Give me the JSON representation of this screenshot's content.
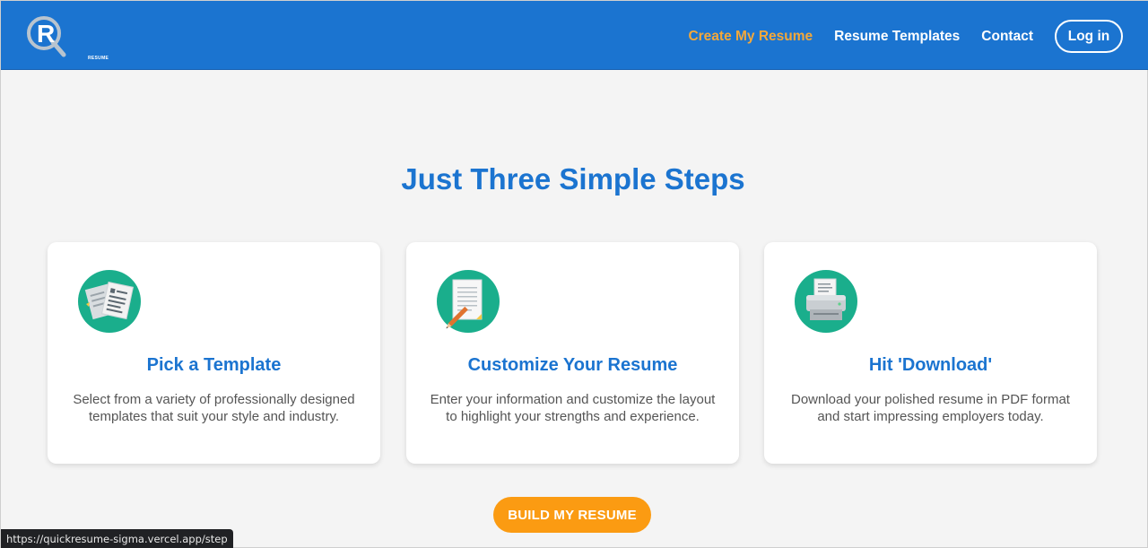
{
  "nav": {
    "logo_sub": "RESUME",
    "links": [
      {
        "label": "Create My Resume",
        "active": true
      },
      {
        "label": "Resume Templates",
        "active": false
      },
      {
        "label": "Contact",
        "active": false
      }
    ],
    "login_label": "Log in"
  },
  "main": {
    "title": "Just Three Simple Steps",
    "steps": [
      {
        "title": "Pick a Template",
        "text": "Select from a variety of professionally designed templates that suit your style and industry.",
        "icon": "documents-icon"
      },
      {
        "title": "Customize Your Resume",
        "text": "Enter your information and customize the layout to highlight your strengths and experience.",
        "icon": "document-pencil-icon"
      },
      {
        "title": "Hit 'Download'",
        "text": "Download your polished resume in PDF format and start impressing employers today.",
        "icon": "printer-icon"
      }
    ],
    "cta_label": "BUILD MY RESUME"
  },
  "status_bar": {
    "url": "https://quickresume-sigma.vercel.app/step"
  },
  "colors": {
    "primary": "#1b74d0",
    "accent": "#fb9b12",
    "active_link": "#f4a83a",
    "icon_bg": "#1aae8c"
  }
}
